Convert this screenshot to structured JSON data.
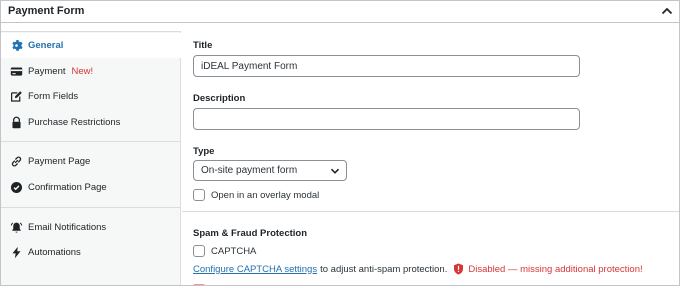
{
  "panel": {
    "title": "Payment Form"
  },
  "sidebar": {
    "items": [
      {
        "label": "General",
        "icon": "gear-icon"
      },
      {
        "label": "Payment",
        "badge": "New!",
        "icon": "credit-card-icon"
      },
      {
        "label": "Form Fields",
        "icon": "edit-icon"
      },
      {
        "label": "Purchase Restrictions",
        "icon": "lock-icon"
      },
      {
        "label": "Payment Page",
        "icon": "link-icon"
      },
      {
        "label": "Confirmation Page",
        "icon": "check-circle-icon"
      },
      {
        "label": "Email Notifications",
        "icon": "bell-icon"
      },
      {
        "label": "Automations",
        "icon": "bolt-icon"
      }
    ]
  },
  "form": {
    "title_label": "Title",
    "title_value": "iDEAL Payment Form",
    "description_label": "Description",
    "description_value": "",
    "type_label": "Type",
    "type_selected": "On-site payment form",
    "overlay_label": "Open in an overlay modal",
    "spam_heading": "Spam & Fraud Protection",
    "captcha_label": "CAPTCHA",
    "captcha_link": "Configure CAPTCHA settings",
    "captcha_text": "to adjust anti-spam protection.",
    "captcha_warning": "Disabled — missing additional protection!"
  },
  "colors": {
    "accent": "#2271b1",
    "warning": "#d63638"
  }
}
